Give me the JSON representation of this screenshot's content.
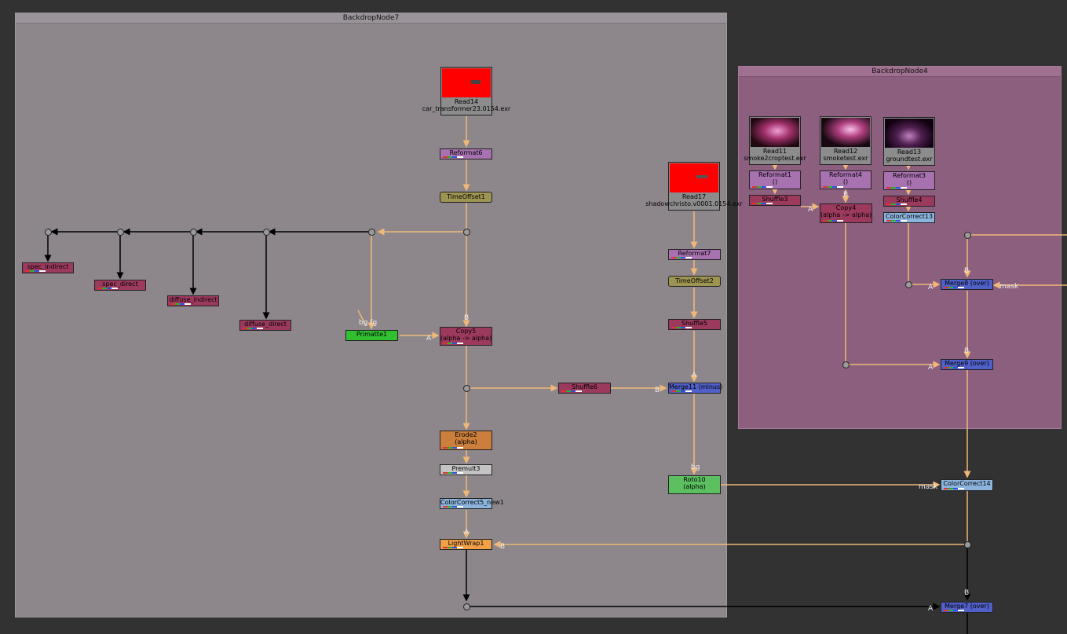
{
  "backdrops": {
    "backdrop7": "BackdropNode7",
    "backdrop4": "BackdropNode4"
  },
  "nodes": {
    "read14": {
      "name": "Read14",
      "file": "car_transformer23.0154.exr"
    },
    "read17": {
      "name": "Read17",
      "file": "shadowchristo.v0001.0154.exr"
    },
    "read11": {
      "name": "Read11",
      "file": "smoke2croptest.exr"
    },
    "read12": {
      "name": "Read12",
      "file": "smoketest.exr"
    },
    "read13": {
      "name": "Read13",
      "file": "groundtest.exr"
    },
    "reformat6": "Reformat6",
    "timeoffset1": "TimeOffset1",
    "reformat7": "Reformat7",
    "timeoffset2": "TimeOffset2",
    "shuffle5": "Shuffle5",
    "merge11": "Merge11 (minus)",
    "copy5": {
      "name": "Copy5",
      "sub": "(alpha -> alpha)"
    },
    "primatte1": "Primatte1",
    "shuffle6": "Shuffle6",
    "erode2": {
      "name": "Erode2",
      "sub": "(alpha)"
    },
    "premult3": "Premult3",
    "colorcorrect5": "ColorCorrect5_new1",
    "lightwrap1": "LightWrap1",
    "roto10": {
      "name": "Roto10",
      "sub": "(alpha)"
    },
    "spec_indirect": "spec_indirect",
    "spec_direct": "spec_direct",
    "diffuse_indirect": "diffuse_indirect",
    "diffuse_direct": "diffuse_direct",
    "reformat1": {
      "name": "Reformat1",
      "sub": "()"
    },
    "reformat4": {
      "name": "Reformat4",
      "sub": "()"
    },
    "reformat3": {
      "name": "Reformat3",
      "sub": "()"
    },
    "shuffle3": "Shuffle3",
    "shuffle4": "Shuffle4",
    "copy4": {
      "name": "Copy4",
      "sub": "(alpha -> alpha)"
    },
    "colorcorrect13": "ColorCorrect13",
    "merge8": "Merge8 (over)",
    "merge9": "Merge9 (over)",
    "colorcorrect14": "ColorCorrect14",
    "merge7": "Merge7 (over)"
  },
  "pipe_labels": {
    "a": "A",
    "b": "B",
    "mask": "mask",
    "bg": "bg",
    "bgfg": "bg fg"
  }
}
